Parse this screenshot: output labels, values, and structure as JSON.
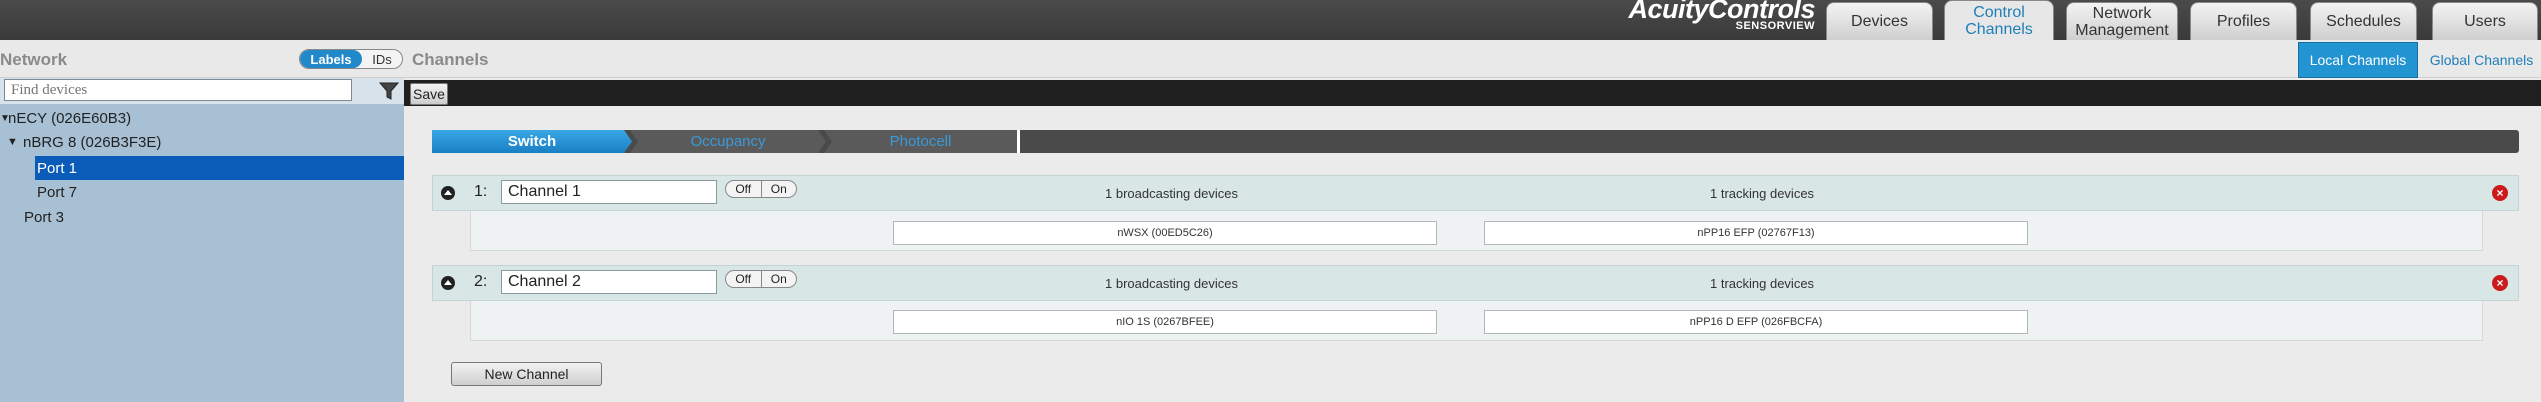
{
  "header": {
    "brand": "AcuityControls",
    "product": "SENSORVIEW",
    "tabs": [
      {
        "label": "Devices"
      },
      {
        "label": "Control Channels"
      },
      {
        "label": "Network Management"
      },
      {
        "label": "Profiles"
      },
      {
        "label": "Schedules"
      },
      {
        "label": "Users"
      }
    ],
    "active_tab": "Control Channels"
  },
  "network_panel": {
    "title": "Network",
    "toggle": {
      "labels": "Labels",
      "ids": "IDs",
      "selected": "Labels"
    },
    "search": {
      "placeholder": "Find devices",
      "value": ""
    },
    "tree": [
      {
        "label": "nECY (026E60B3)",
        "expanded": true
      },
      {
        "label": "nBRG 8 (026B3F3E)",
        "expanded": true
      },
      {
        "label": "Port 1",
        "selected": true
      },
      {
        "label": "Port 7"
      },
      {
        "label": "Port 3"
      }
    ]
  },
  "channels_panel": {
    "title": "Channels",
    "scope_tabs": {
      "local": "Local Channels",
      "global": "Global Channels",
      "selected": "Local Channels"
    },
    "save_label": "Save",
    "channel_tabs": [
      {
        "label": "Switch"
      },
      {
        "label": "Occupancy"
      },
      {
        "label": "Photocell"
      }
    ],
    "active_channel_tab": "Switch",
    "channels": [
      {
        "number": "1:",
        "name": "Channel 1",
        "off_label": "Off",
        "on_label": "On",
        "broadcasting": "1 broadcasting devices",
        "tracking": "1 tracking devices",
        "broadcast_device": "nWSX (00ED5C26)",
        "tracking_device": "nPP16 EFP (02767F13)"
      },
      {
        "number": "2:",
        "name": "Channel 2",
        "off_label": "Off",
        "on_label": "On",
        "broadcasting": "1 broadcasting devices",
        "tracking": "1 tracking devices",
        "broadcast_device": "nIO 1S (0267BFEE)",
        "tracking_device": "nPP16 D EFP (026FBCFA)"
      }
    ],
    "new_channel_label": "New Channel"
  },
  "colors": {
    "accent": "#2394d2",
    "selection": "#0b5cb8",
    "panel": "#a8c0d3",
    "delete": "#cc1a1a"
  }
}
